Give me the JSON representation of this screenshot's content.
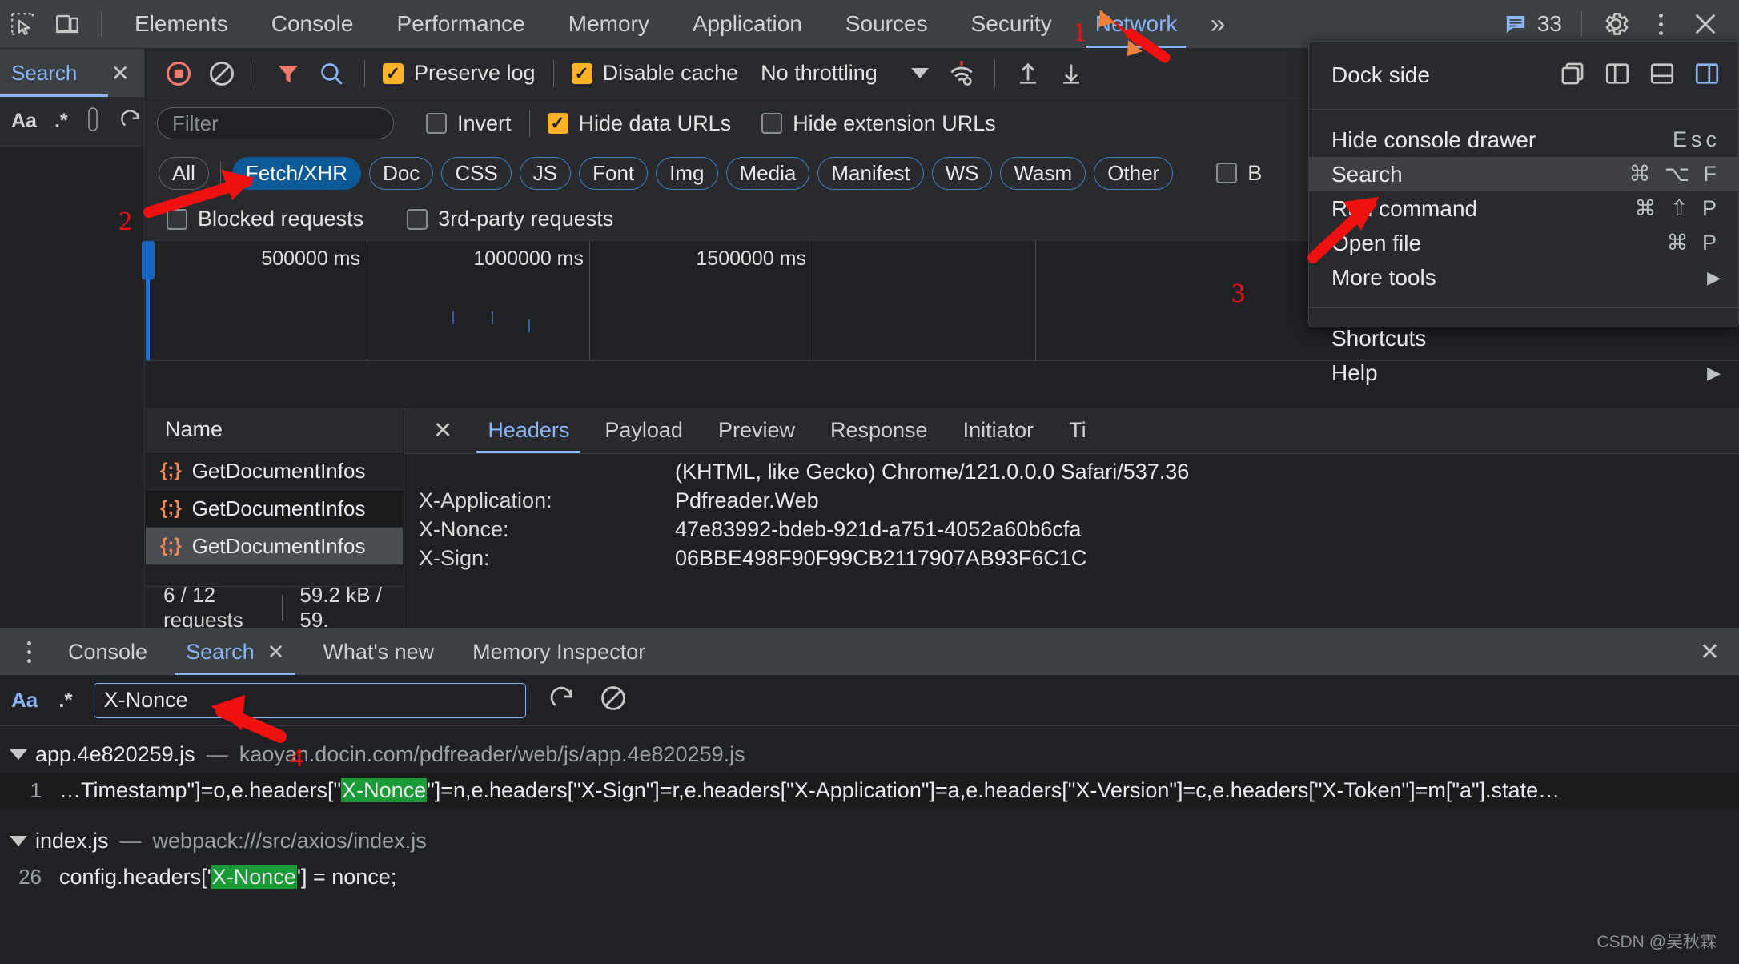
{
  "topbar": {
    "inspect_icon": "inspect-cursor-icon",
    "device_icon": "device-toolbar-icon",
    "tabs": [
      {
        "label": "Elements",
        "active": false
      },
      {
        "label": "Console",
        "active": false
      },
      {
        "label": "Performance",
        "active": false
      },
      {
        "label": "Memory",
        "active": false
      },
      {
        "label": "Application",
        "active": false
      },
      {
        "label": "Sources",
        "active": false
      },
      {
        "label": "Security",
        "active": false
      },
      {
        "label": "Network",
        "active": true
      }
    ],
    "more_tabs": "»",
    "message_count": "33",
    "settings_icon": "gear-icon",
    "menu_icon": "kebab-menu-icon",
    "close_icon": "close-icon"
  },
  "left_search_panel": {
    "tab_label": "Search",
    "close_icon": "close-icon",
    "match_case": "Aa",
    "regex": ".*",
    "refresh_icon": "refresh-icon",
    "clear_icon": "clear-icon"
  },
  "network": {
    "toolbar": {
      "record_icon": "record-stop-icon",
      "clear_icon": "clear-icon",
      "filter_icon": "filter-funnel-icon",
      "search_icon": "search-icon",
      "preserve_log": {
        "label": "Preserve log",
        "checked": true
      },
      "disable_cache": {
        "label": "Disable cache",
        "checked": true
      },
      "throttling": "No throttling",
      "wifi_icon": "network-conditions-icon",
      "import_icon": "import-har-icon",
      "export_icon": "export-har-icon"
    },
    "filterbar": {
      "filter_placeholder": "Filter",
      "invert": {
        "label": "Invert",
        "checked": false
      },
      "hide_data_urls": {
        "label": "Hide data URLs",
        "checked": true
      },
      "hide_extension_urls": {
        "label": "Hide extension URLs",
        "checked": false
      }
    },
    "type_filters": [
      {
        "label": "All",
        "active": false,
        "style": "plain"
      },
      {
        "label": "Fetch/XHR",
        "active": true,
        "style": "active"
      },
      {
        "label": "Doc",
        "active": false,
        "style": "outline"
      },
      {
        "label": "CSS",
        "active": false,
        "style": "outline"
      },
      {
        "label": "JS",
        "active": false,
        "style": "outline"
      },
      {
        "label": "Font",
        "active": false,
        "style": "outline"
      },
      {
        "label": "Img",
        "active": false,
        "style": "outline"
      },
      {
        "label": "Media",
        "active": false,
        "style": "outline"
      },
      {
        "label": "Manifest",
        "active": false,
        "style": "outline"
      },
      {
        "label": "WS",
        "active": false,
        "style": "outline"
      },
      {
        "label": "Wasm",
        "active": false,
        "style": "outline"
      },
      {
        "label": "Other",
        "active": false,
        "style": "outline"
      }
    ],
    "extra_checks": [
      {
        "label": "Blocked requests",
        "checked": false
      },
      {
        "label": "3rd-party requests",
        "checked": false
      }
    ],
    "blocked_partial_label": "B",
    "overview": {
      "ticks": [
        "500000 ms",
        "1000000 ms",
        "1500000 ms"
      ]
    },
    "table": {
      "column_header": "Name",
      "rows": [
        {
          "icon": "json-icon",
          "name": "GetDocumentInfos",
          "selected": false
        },
        {
          "icon": "json-icon",
          "name": "GetDocumentInfos",
          "selected": false
        },
        {
          "icon": "json-icon",
          "name": "GetDocumentInfos",
          "selected": true
        }
      ],
      "footer_requests": "6 / 12 requests",
      "footer_size": "59.2 kB / 59."
    },
    "details": {
      "close_icon": "close-icon",
      "tabs": [
        {
          "label": "Headers",
          "active": true
        },
        {
          "label": "Payload",
          "active": false
        },
        {
          "label": "Preview",
          "active": false
        },
        {
          "label": "Response",
          "active": false
        },
        {
          "label": "Initiator",
          "active": false
        },
        {
          "label": "Ti",
          "active": false
        }
      ],
      "headers": [
        {
          "key": "",
          "value": "(KHTML, like Gecko) Chrome/121.0.0.0 Safari/537.36"
        },
        {
          "key": "X-Application:",
          "value": "Pdfreader.Web"
        },
        {
          "key": "X-Nonce:",
          "value": "47e83992-bdeb-921d-a751-4052a60b6cfa"
        },
        {
          "key": "X-Sign:",
          "value": "06BBE498F90F99CB2117907AB93F6C1C"
        }
      ]
    }
  },
  "dock_menu": {
    "dock_side_label": "Dock side",
    "dock_icons": [
      {
        "name": "undock-separate-window-icon",
        "active": false
      },
      {
        "name": "dock-to-left-icon",
        "active": false
      },
      {
        "name": "dock-to-bottom-icon",
        "active": false
      },
      {
        "name": "dock-to-right-icon",
        "active": true
      }
    ],
    "items": [
      {
        "label": "Hide console drawer",
        "shortcut": "Esc",
        "highlighted": false,
        "submenu": false
      },
      {
        "label": "Search",
        "shortcut": "⌘ ⌥ F",
        "highlighted": true,
        "submenu": false
      },
      {
        "label": "Run command",
        "shortcut": "⌘ ⇧ P",
        "highlighted": false,
        "submenu": false
      },
      {
        "label": "Open file",
        "shortcut": "⌘ P",
        "highlighted": false,
        "submenu": false
      },
      {
        "label": "More tools",
        "shortcut": "",
        "highlighted": false,
        "submenu": true
      }
    ],
    "items2": [
      {
        "label": "Shortcuts",
        "shortcut": "",
        "highlighted": false,
        "submenu": false
      },
      {
        "label": "Help",
        "shortcut": "",
        "highlighted": false,
        "submenu": true
      }
    ]
  },
  "drawer": {
    "kebab_icon": "kebab-menu-icon",
    "tabs": [
      {
        "label": "Console",
        "active": false,
        "closable": false
      },
      {
        "label": "Search",
        "active": true,
        "closable": true
      },
      {
        "label": "What's new",
        "active": false,
        "closable": false
      },
      {
        "label": "Memory Inspector",
        "active": false,
        "closable": false
      }
    ],
    "close_icon": "close-icon",
    "search": {
      "match_case": "Aa",
      "regex": ".*",
      "query": "X-Nonce",
      "refresh_icon": "refresh-icon",
      "clear_icon": "clear-icon"
    },
    "results": [
      {
        "file": "app.4e820259.js",
        "dash": "—",
        "url": "kaoyan.docin.com/pdfreader/web/js/app.4e820259.js",
        "line_number": "1",
        "code_before": "…Timestamp\"]=o,e.headers[\"",
        "code_match": "X-Nonce",
        "code_after": "\"]=n,e.headers[\"X-Sign\"]=r,e.headers[\"X-Application\"]=a,e.headers[\"X-Version\"]=c,e.headers[\"X-Token\"]=m[\"a\"].state…"
      },
      {
        "file": "index.js",
        "dash": "—",
        "url": "webpack:///src/axios/index.js",
        "line_number": "26",
        "code_before": "config.headers['",
        "code_match": "X-Nonce",
        "code_after": "'] = nonce;"
      }
    ]
  },
  "annotations": [
    {
      "number": "1",
      "target": "network-tab"
    },
    {
      "number": "2",
      "target": "fetch-xhr-filter"
    },
    {
      "number": "3",
      "target": "search-menu-item"
    },
    {
      "number": "4",
      "target": "search-query-input"
    }
  ],
  "watermark": "CSDN @吴秋霖",
  "colors": {
    "accent_blue": "#8ab4f8",
    "active_pill": "#0b5996",
    "checkbox_on": "#fdb22a",
    "match_highlight": "#1a9b37",
    "json_icon": "#f28b54",
    "annotation_red": "#f01010"
  }
}
